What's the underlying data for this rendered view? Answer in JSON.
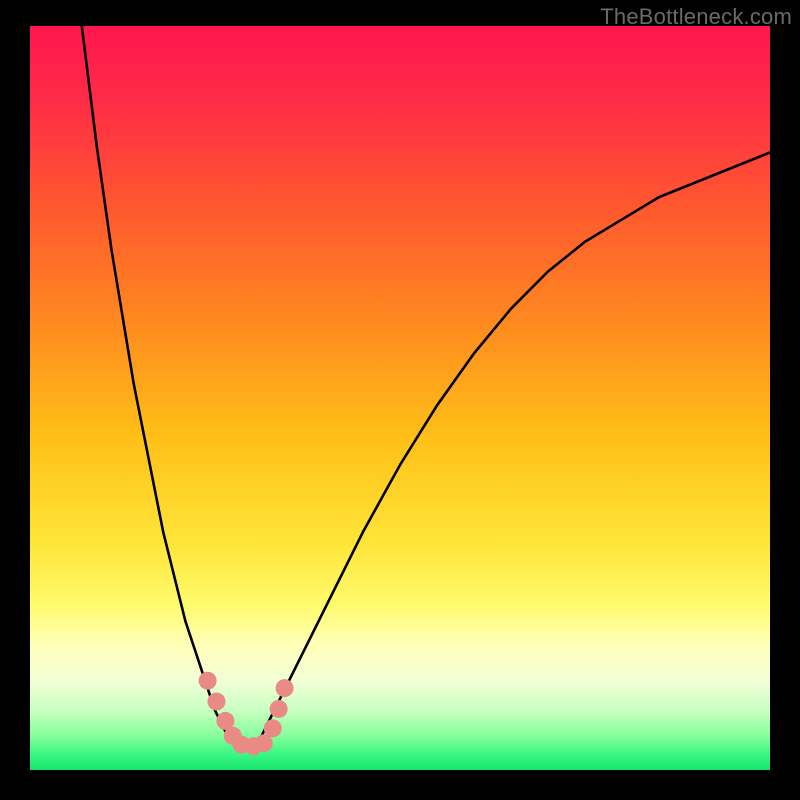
{
  "watermark": "TheBottleneck.com",
  "chart_data": {
    "type": "line",
    "title": "",
    "xlabel": "",
    "ylabel": "",
    "xlim": [
      0,
      100
    ],
    "ylim": [
      0,
      100
    ],
    "grid": false,
    "legend": false,
    "background": {
      "kind": "vertical-gradient",
      "stops": [
        {
          "pos": 0.0,
          "color": "#ff1750"
        },
        {
          "pos": 0.1,
          "color": "#ff2b46"
        },
        {
          "pos": 0.25,
          "color": "#ff5a2e"
        },
        {
          "pos": 0.4,
          "color": "#ff8a1f"
        },
        {
          "pos": 0.55,
          "color": "#ffbf17"
        },
        {
          "pos": 0.7,
          "color": "#ffe63a"
        },
        {
          "pos": 0.78,
          "color": "#fffb70"
        },
        {
          "pos": 0.83,
          "color": "#ffffb5"
        },
        {
          "pos": 0.88,
          "color": "#f2ffd6"
        },
        {
          "pos": 0.92,
          "color": "#c8ffc0"
        },
        {
          "pos": 0.95,
          "color": "#8effa0"
        },
        {
          "pos": 0.98,
          "color": "#38f783"
        },
        {
          "pos": 1.0,
          "color": "#17e56e"
        }
      ]
    },
    "series": [
      {
        "name": "left-arm",
        "color": "#000000",
        "x": [
          7,
          8,
          9,
          10,
          11,
          12,
          13,
          14,
          15,
          16,
          17,
          18,
          19,
          20,
          21,
          22,
          23,
          24,
          25,
          26,
          27
        ],
        "y": [
          100,
          92,
          84,
          77,
          70,
          64,
          58,
          52,
          47,
          42,
          37,
          32,
          28,
          24,
          20,
          17,
          14,
          11,
          8,
          6,
          4
        ]
      },
      {
        "name": "right-arm",
        "color": "#000000",
        "x": [
          31,
          33,
          36,
          40,
          45,
          50,
          55,
          60,
          65,
          70,
          75,
          80,
          85,
          90,
          95,
          100
        ],
        "y": [
          4,
          8,
          14,
          22,
          32,
          41,
          49,
          56,
          62,
          67,
          71,
          74,
          77,
          79,
          81,
          83
        ]
      },
      {
        "name": "valley-floor",
        "color": "#000000",
        "x": [
          27,
          28,
          29,
          30,
          31
        ],
        "y": [
          4,
          3,
          3,
          3,
          4
        ]
      }
    ],
    "markers": [
      {
        "name": "dot",
        "x": 24.0,
        "y": 12.0,
        "color": "#e98a85",
        "r": 9
      },
      {
        "name": "dot",
        "x": 25.2,
        "y": 9.2,
        "color": "#e98a85",
        "r": 9
      },
      {
        "name": "dot",
        "x": 26.4,
        "y": 6.6,
        "color": "#e98a85",
        "r": 9
      },
      {
        "name": "dot",
        "x": 27.4,
        "y": 4.6,
        "color": "#e98a85",
        "r": 9
      },
      {
        "name": "dot",
        "x": 28.6,
        "y": 3.4,
        "color": "#e98a85",
        "r": 9
      },
      {
        "name": "dot",
        "x": 30.2,
        "y": 3.2,
        "color": "#e98a85",
        "r": 9
      },
      {
        "name": "dot",
        "x": 31.6,
        "y": 3.6,
        "color": "#e98a85",
        "r": 9
      },
      {
        "name": "dot",
        "x": 32.8,
        "y": 5.6,
        "color": "#e98a85",
        "r": 9
      },
      {
        "name": "dot",
        "x": 33.6,
        "y": 8.2,
        "color": "#e98a85",
        "r": 9
      },
      {
        "name": "dot",
        "x": 34.4,
        "y": 11.0,
        "color": "#e98a85",
        "r": 9
      }
    ]
  }
}
